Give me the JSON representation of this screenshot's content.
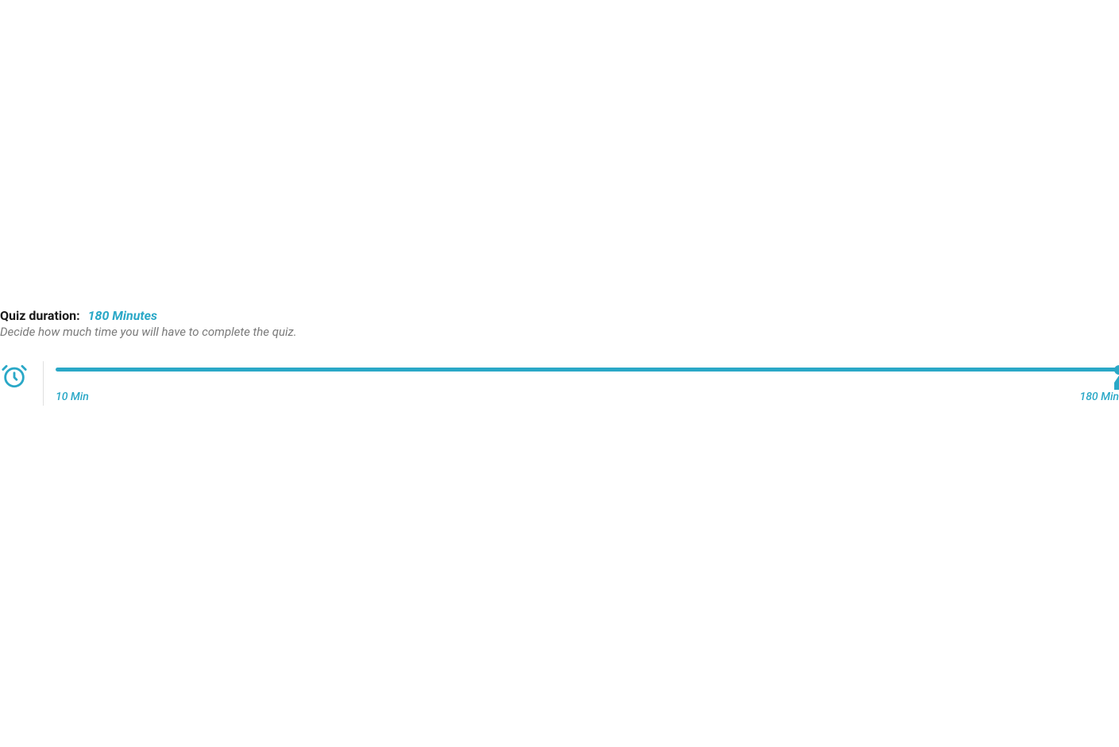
{
  "duration": {
    "label": "Quiz duration:",
    "value": "180 Minutes",
    "help": "Decide how much time you will have to complete the quiz."
  },
  "slider": {
    "min_label": "10 Min",
    "max_label": "180 Min",
    "min": 10,
    "max": 180,
    "current": 180,
    "percent": 100
  },
  "colors": {
    "accent": "#2aa8c7"
  }
}
